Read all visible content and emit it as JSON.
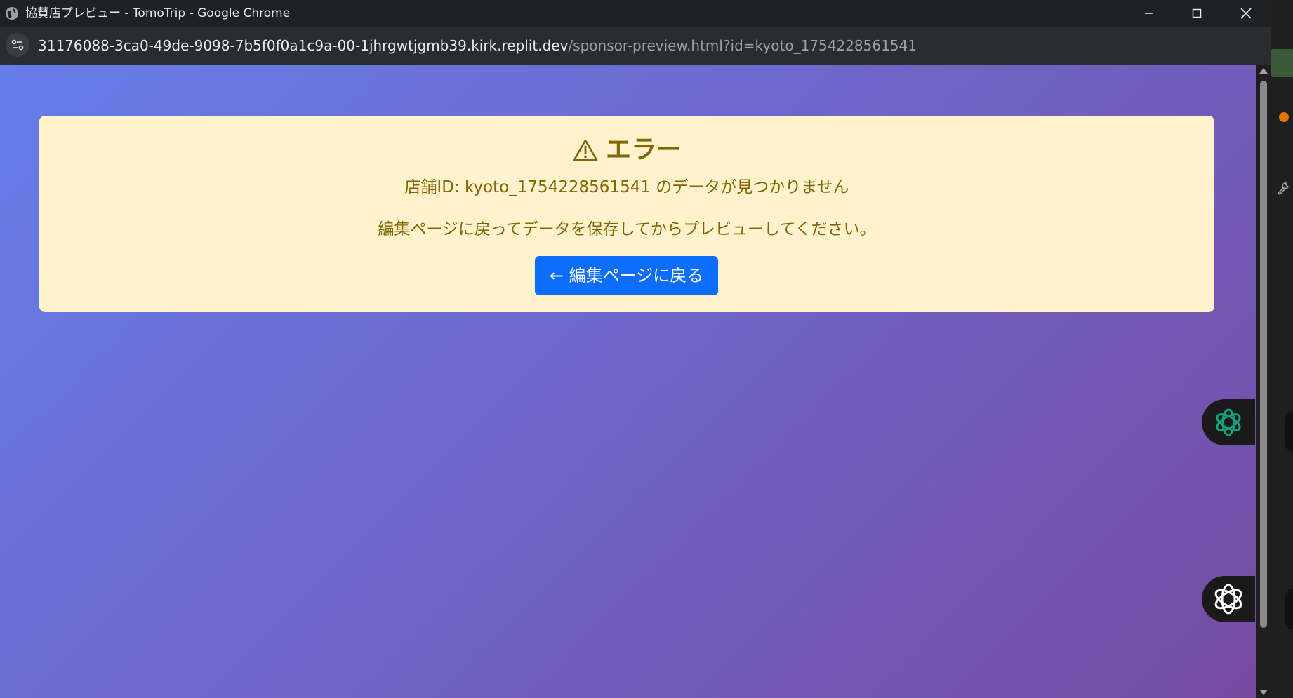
{
  "window": {
    "title": "協賛店プレビュー - TomoTrip - Google Chrome"
  },
  "address_bar": {
    "url_host": "31176088-3ca0-49de-9098-7b5f0f0a1c9a-00-1jhrgwtjgmb39.kirk.replit.dev",
    "url_path": "/sponsor-preview.html?id=kyoto_1754228561541"
  },
  "alert": {
    "heading": "エラー",
    "message": "店舗ID: kyoto_1754228561541 のデータが見つかりません",
    "instruction": "編集ページに戻ってデータを保存してからプレビューしてください。",
    "back_button_label": "← 編集ページに戻る"
  },
  "colors": {
    "gradient_start": "#667eea",
    "gradient_end": "#764ba2",
    "alert_bg": "#fff3cd",
    "alert_text": "#856404",
    "button_bg": "#0d6efd"
  },
  "icons": [
    "globe-icon",
    "minimize-icon",
    "maximize-icon",
    "close-icon",
    "site-info-icon",
    "warning-icon",
    "chatgpt-green-icon",
    "chatgpt-white-icon",
    "wrench-icon"
  ]
}
